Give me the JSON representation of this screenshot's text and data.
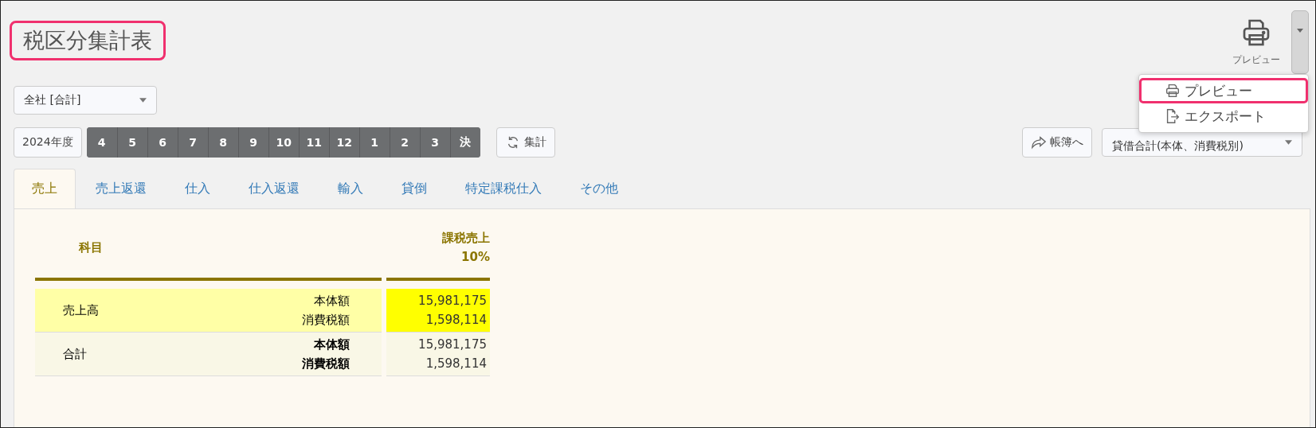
{
  "title": "税区分集計表",
  "toolbar": {
    "preview_label": "プレビュー"
  },
  "menu": {
    "items": [
      {
        "label": "プレビュー",
        "kind": "print",
        "selected": true
      },
      {
        "label": "エクスポート",
        "kind": "export",
        "selected": false
      }
    ]
  },
  "company_select": {
    "value": "全社 [合計]"
  },
  "fiscal_year": "2024年度",
  "months": [
    "4",
    "5",
    "6",
    "7",
    "8",
    "9",
    "10",
    "11",
    "12",
    "1",
    "2",
    "3",
    "決"
  ],
  "aggregate_button": "集計",
  "ledger_button": "帳簿へ",
  "balance_select": {
    "value": "貸借合計(本体、消費税別)"
  },
  "tabs": [
    {
      "label": "売上",
      "selected": true
    },
    {
      "label": "売上返還",
      "selected": false
    },
    {
      "label": "仕入",
      "selected": false
    },
    {
      "label": "仕入返還",
      "selected": false
    },
    {
      "label": "輸入",
      "selected": false
    },
    {
      "label": "貸倒",
      "selected": false
    },
    {
      "label": "特定課税仕入",
      "selected": false
    },
    {
      "label": "その他",
      "selected": false
    }
  ],
  "table": {
    "columns": [
      {
        "lines": [
          "科目"
        ]
      },
      {
        "lines": [
          "課税売上",
          "10%"
        ]
      }
    ],
    "rows": [
      {
        "kind": "item",
        "name": "売上高",
        "highlighted": true,
        "labels": [
          "本体額",
          "消費税額"
        ],
        "values": [
          "15,981,175",
          "1,598,114"
        ]
      },
      {
        "kind": "total",
        "name": "合計",
        "highlighted": false,
        "labels": [
          "本体額",
          "消費税額"
        ],
        "values": [
          "15,981,175",
          "1,598,114"
        ]
      }
    ]
  }
}
